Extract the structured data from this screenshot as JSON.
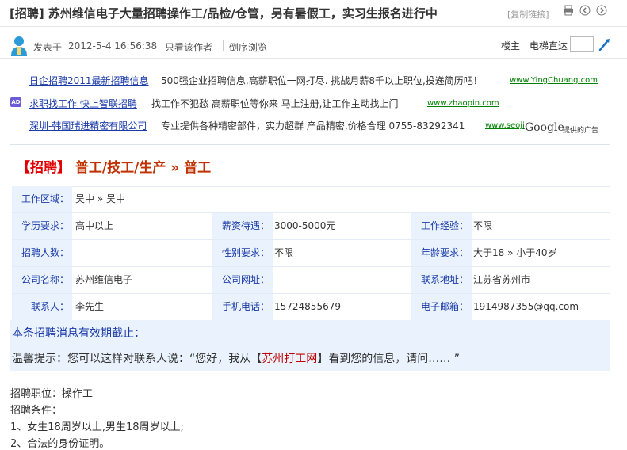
{
  "thread": {
    "title": "[招聘] 苏州维信电子大量招聘操作工/品检/仓管，另有暑假工，实习生报名进行中",
    "copy_link": "[复制链接]"
  },
  "meta": {
    "posted_label": "发表于",
    "posted_time": "2012-5-4 16:56:38",
    "author_only": "只看该作者",
    "reverse_view": "倒序浏览",
    "floor_label": "楼主",
    "jump_label": "电梯直达",
    "jump_value": ""
  },
  "ads": [
    {
      "link": "日企招聘2011最新招聘信息",
      "desc": "500强企业招聘信息,高薪职位一网打尽. 挑战月薪8千以上职位,投递简历吧！",
      "url": "www.YingChuang.com"
    },
    {
      "badge": "AD",
      "link": "求职找工作 快上智联招聘",
      "desc": "找工作不犯愁 高薪职位等你来 马上注册,让工作主动找上门",
      "url": "www.zhaopin.com"
    },
    {
      "link": "深圳-韩国瑞进精密有限公司",
      "desc": "专业提供各种精密部件，实力超群 产品精密,价格合理  0755-83292341",
      "url": "www.seoji"
    }
  ],
  "google": {
    "logo": "Google",
    "note": "提供的广告"
  },
  "job": {
    "title_bracket": "【招聘】",
    "title_category": "普工/技工/生产 » 普工",
    "rows": [
      [
        {
          "label": "工作区域：",
          "value": "吴中  » 吴中"
        }
      ],
      [
        {
          "label": "学历要求：",
          "value": "高中以上"
        },
        {
          "label": "薪资待遇：",
          "value": "3000-5000元"
        },
        {
          "label": "工作经验：",
          "value": "不限"
        }
      ],
      [
        {
          "label": "招聘人数：",
          "value": ""
        },
        {
          "label": "性别要求：",
          "value": "不限"
        },
        {
          "label": "年龄要求：",
          "value": "大于18 » 小于40岁"
        }
      ],
      [
        {
          "label": "公司名称：",
          "value": "苏州维信电子"
        },
        {
          "label": "公司网址：",
          "value": ""
        },
        {
          "label": "联系地址：",
          "value": "江苏省苏州市"
        }
      ],
      [
        {
          "label": "联系人：",
          "value": "李先生"
        },
        {
          "label": "手机电话：",
          "value": "15724855679"
        },
        {
          "label": "电子邮箱：",
          "value": "1914987355@qq.com"
        }
      ]
    ],
    "expiry": "本条招聘消息有效期截止：",
    "tip_pre": "温馨提示：您可以这样对联系人说：“您好，我从【",
    "tip_site": "苏州打工网",
    "tip_post": "】看到您的信息，请问…… ”"
  },
  "body": [
    "招聘职位：操作工",
    "招聘条件：",
    "1、女生18周岁以上,男生18周岁以上;",
    "2、合法的身份证明。"
  ],
  "icons": {
    "print": "print-icon",
    "prev": "prev-thread-icon",
    "next": "next-thread-icon",
    "avatar": "user-avatar-icon",
    "jump": "jump-go-icon"
  }
}
